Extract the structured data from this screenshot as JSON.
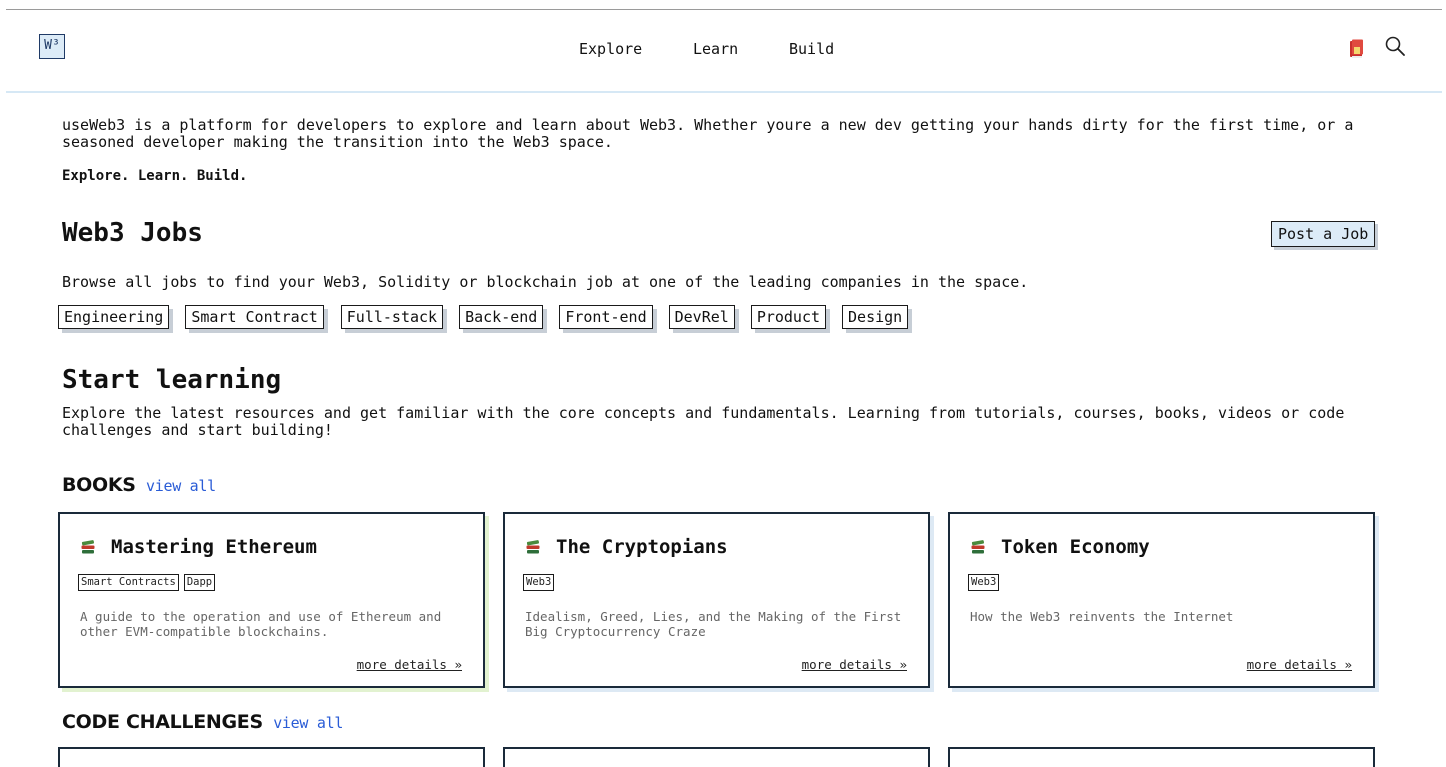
{
  "header": {
    "logo": "W³",
    "nav": [
      "Explore",
      "Learn",
      "Build"
    ]
  },
  "intro": {
    "text": "useWeb3 is a platform for developers to explore and learn about Web3. Whether youre a new dev getting your hands dirty for the first time, or a seasoned developer making the transition into the Web3 space.",
    "tagline": "Explore. Learn. Build."
  },
  "jobs": {
    "title": "Web3 Jobs",
    "post_label": "Post a Job",
    "description": "Browse all jobs to find your Web3, Solidity or blockchain job at one of the leading companies in the space.",
    "categories": [
      "Engineering",
      "Smart Contract",
      "Full-stack",
      "Back-end",
      "Front-end",
      "DevRel",
      "Product",
      "Design"
    ]
  },
  "learning": {
    "title": "Start learning",
    "description": "Explore the latest resources and get familiar with the core concepts and fundamentals. Learning from tutorials, courses, books, videos or code challenges and start building!"
  },
  "books": {
    "title": "BOOKS",
    "view_all": "view all",
    "items": [
      {
        "title": "Mastering Ethereum",
        "tags": [
          "Smart Contracts",
          "Dapp"
        ],
        "description": "A guide to the operation and use of Ethereum and other EVM-compatible blockchains.",
        "more": "more details »"
      },
      {
        "title": "The Cryptopians",
        "tags": [
          "Web3"
        ],
        "description": "Idealism, Greed, Lies, and the Making of the First Big Cryptocurrency Craze",
        "more": "more details »"
      },
      {
        "title": "Token Economy",
        "tags": [
          "Web3"
        ],
        "description": "How the Web3 reinvents the Internet",
        "more": "more details »"
      }
    ]
  },
  "code_challenges": {
    "title": "CODE CHALLENGES",
    "view_all": "view all"
  },
  "colors": {
    "accent_blue": "#2a5cd6",
    "button_bg": "#dcebf7"
  },
  "icons": {
    "book": "books-icon",
    "search": "search-icon",
    "header_book": "book-icon"
  }
}
